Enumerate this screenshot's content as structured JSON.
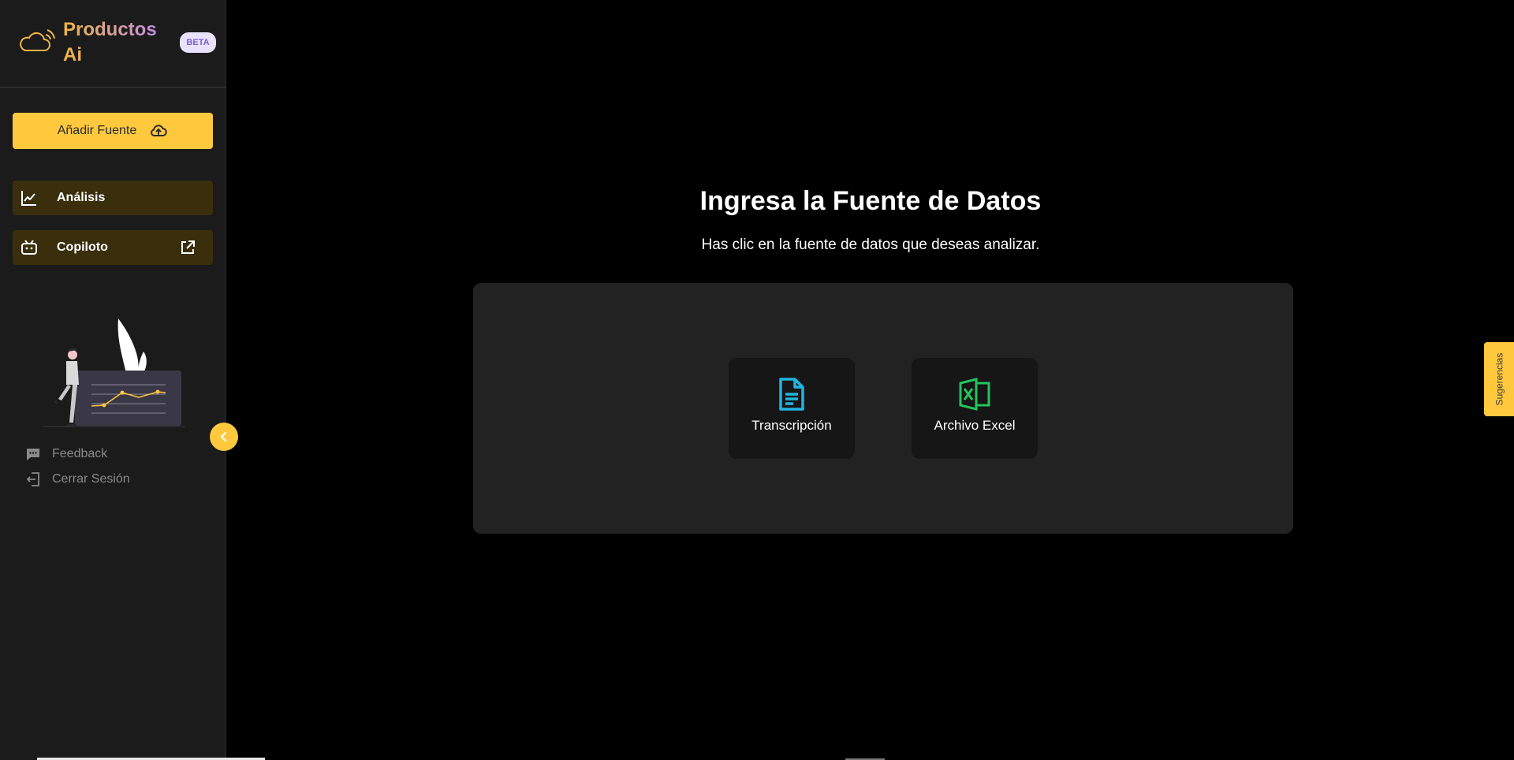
{
  "brand": {
    "name": "Productos\nAi",
    "badge": "BETA"
  },
  "sidebar": {
    "add_source_label": "Añadir Fuente",
    "items": [
      {
        "label": "Análisis",
        "icon": "line-chart-icon"
      },
      {
        "label": "Copiloto",
        "icon": "robot-icon",
        "external": true
      }
    ],
    "footer": [
      {
        "label": "Feedback",
        "icon": "message-dots-icon"
      },
      {
        "label": "Cerrar Sesión",
        "icon": "logout-icon"
      }
    ]
  },
  "main": {
    "title": "Ingresa la Fuente de Datos",
    "subtitle": "Has clic en la fuente de datos que deseas analizar.",
    "sources": [
      {
        "label": "Transcripción",
        "icon": "document-icon",
        "color": "#1fb6e0"
      },
      {
        "label": "Archivo Excel",
        "icon": "excel-icon",
        "color": "#22c55e"
      }
    ]
  },
  "suggest_tab": "Sugerencias",
  "colors": {
    "accent": "#ffc83d",
    "sidebar_bg": "#1b1b1b",
    "nav_item_bg": "#3a2e0d",
    "panel_bg": "#222222",
    "card_bg": "#161616"
  }
}
